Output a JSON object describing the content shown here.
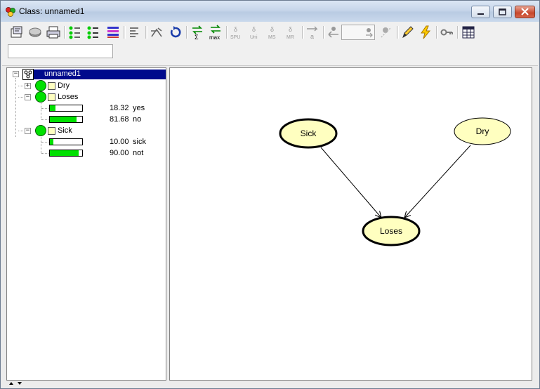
{
  "window": {
    "title": "Class: unnamed1"
  },
  "toolbar": {
    "buttons": [
      {
        "icon": "properties-icon"
      },
      {
        "icon": "compile-icon"
      },
      {
        "icon": "print-icon"
      },
      {
        "icon": "expand-all-icon"
      },
      {
        "icon": "collapse-all-icon"
      },
      {
        "icon": "node-list-icon"
      },
      {
        "icon": "align-icon"
      },
      {
        "icon": "propagate-icon"
      },
      {
        "icon": "reset-icon"
      },
      {
        "icon": "sum-propagate-icon"
      },
      {
        "icon": "max-propagate-icon"
      },
      {
        "icon": "spu-icon"
      },
      {
        "icon": "uni-icon"
      },
      {
        "icon": "ms-icon"
      },
      {
        "icon": "mr-icon"
      },
      {
        "icon": "value-of-info-icon"
      },
      {
        "icon": "back-icon"
      },
      {
        "icon": "forward-icon"
      },
      {
        "icon": "pencil-icon"
      },
      {
        "icon": "lightning-icon"
      },
      {
        "icon": "key-icon"
      },
      {
        "icon": "table-icon"
      }
    ],
    "small_labels": {
      "max": "max",
      "spu": "SPU",
      "uni": "Uni",
      "ms": "MS",
      "mr": "MR",
      "a": "a"
    },
    "search_value": ""
  },
  "tree": {
    "root": {
      "label": "unnamed1"
    },
    "nodes": [
      {
        "label": "Dry",
        "expanded": false,
        "states": []
      },
      {
        "label": "Loses",
        "expanded": true,
        "states": [
          {
            "value": "18.32",
            "name": "yes",
            "fraction": 0.1832
          },
          {
            "value": "81.68",
            "name": "no",
            "fraction": 0.8168
          }
        ]
      },
      {
        "label": "Sick",
        "expanded": true,
        "states": [
          {
            "value": "10.00",
            "name": "sick",
            "fraction": 0.1
          },
          {
            "value": "90.00",
            "name": "not",
            "fraction": 0.9
          }
        ]
      }
    ],
    "expander_plus": "+",
    "expander_minus": "−"
  },
  "graph": {
    "nodes": [
      {
        "label": "Sick"
      },
      {
        "label": "Dry"
      },
      {
        "label": "Loses"
      }
    ],
    "edges": [
      {
        "from": "Sick",
        "to": "Loses"
      },
      {
        "from": "Dry",
        "to": "Loses"
      }
    ]
  },
  "colors": {
    "node_fill": "#ffffc0",
    "state_bar": "#00e000",
    "selection": "#000a8c"
  }
}
